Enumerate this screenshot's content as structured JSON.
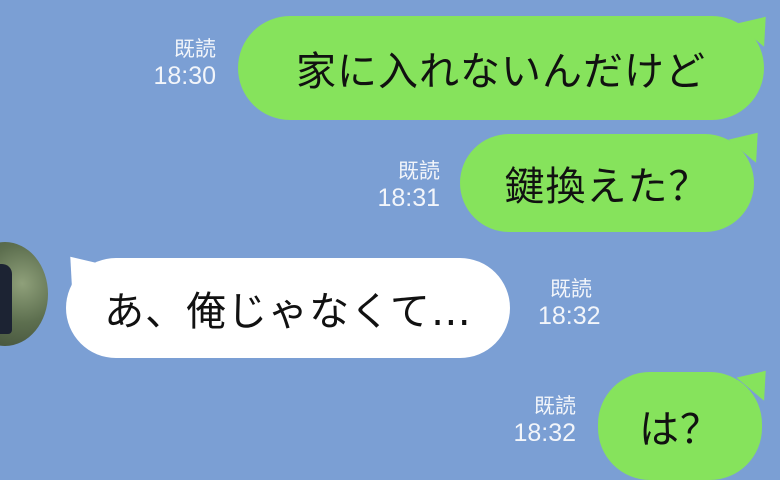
{
  "messages": [
    {
      "side": "right",
      "text": "家に入れないんだけど",
      "read": "既読",
      "time": "18:30"
    },
    {
      "side": "right",
      "text": "鍵換えた？",
      "read": "既読",
      "time": "18:31"
    },
    {
      "side": "left",
      "text": "あ、俺じゃなくて…",
      "read": "既読",
      "time": "18:32"
    },
    {
      "side": "right",
      "text": "は？",
      "read": "既読",
      "time": "18:32"
    }
  ],
  "colors": {
    "background": "#7b9fd4",
    "sent_bubble": "#86e35c",
    "received_bubble": "#ffffff",
    "meta_text": "#f2f5fa"
  },
  "icons": {
    "avatar": "user-avatar-photo"
  }
}
